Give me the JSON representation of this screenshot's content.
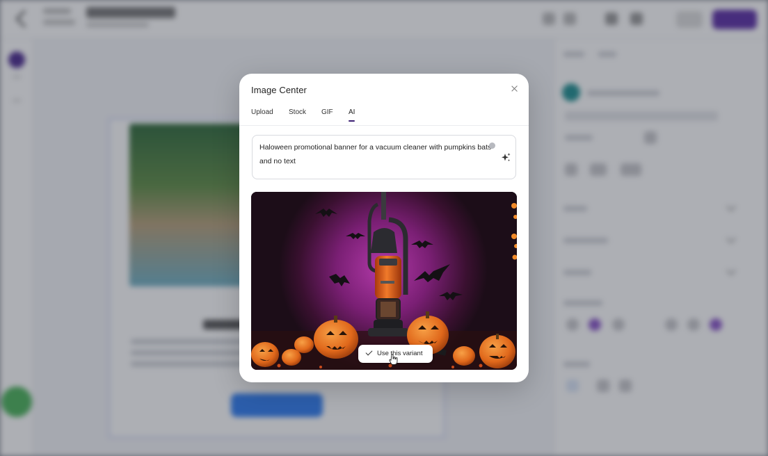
{
  "modal": {
    "title": "Image Center",
    "close_label": "×",
    "tabs": [
      {
        "label": "Upload",
        "active": false
      },
      {
        "label": "Stock",
        "active": false
      },
      {
        "label": "GIF",
        "active": false
      },
      {
        "label": "AI",
        "active": true
      }
    ],
    "prompt": {
      "value": "Haloween promotional banner for a vacuum cleaner with pumpkins bats and no text"
    },
    "result": {
      "image_icon": "ai-generated-image",
      "use_variant_label": "Use this variant",
      "check_icon": "check-icon"
    }
  },
  "colors": {
    "accent": "#3b1f73",
    "primary_purple": "#5b2ea6",
    "pumpkin_orange": "#e0681b",
    "glow_purple": "#8e2a8f"
  }
}
